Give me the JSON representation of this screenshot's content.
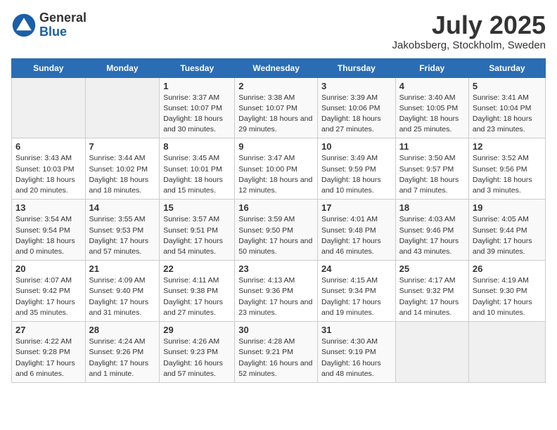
{
  "header": {
    "logo_general": "General",
    "logo_blue": "Blue",
    "month": "July 2025",
    "location": "Jakobsberg, Stockholm, Sweden"
  },
  "weekdays": [
    "Sunday",
    "Monday",
    "Tuesday",
    "Wednesday",
    "Thursday",
    "Friday",
    "Saturday"
  ],
  "weeks": [
    [
      {
        "day": "",
        "empty": true
      },
      {
        "day": "",
        "empty": true
      },
      {
        "day": "1",
        "sunrise": "Sunrise: 3:37 AM",
        "sunset": "Sunset: 10:07 PM",
        "daylight": "Daylight: 18 hours and 30 minutes."
      },
      {
        "day": "2",
        "sunrise": "Sunrise: 3:38 AM",
        "sunset": "Sunset: 10:07 PM",
        "daylight": "Daylight: 18 hours and 29 minutes."
      },
      {
        "day": "3",
        "sunrise": "Sunrise: 3:39 AM",
        "sunset": "Sunset: 10:06 PM",
        "daylight": "Daylight: 18 hours and 27 minutes."
      },
      {
        "day": "4",
        "sunrise": "Sunrise: 3:40 AM",
        "sunset": "Sunset: 10:05 PM",
        "daylight": "Daylight: 18 hours and 25 minutes."
      },
      {
        "day": "5",
        "sunrise": "Sunrise: 3:41 AM",
        "sunset": "Sunset: 10:04 PM",
        "daylight": "Daylight: 18 hours and 23 minutes."
      }
    ],
    [
      {
        "day": "6",
        "sunrise": "Sunrise: 3:43 AM",
        "sunset": "Sunset: 10:03 PM",
        "daylight": "Daylight: 18 hours and 20 minutes."
      },
      {
        "day": "7",
        "sunrise": "Sunrise: 3:44 AM",
        "sunset": "Sunset: 10:02 PM",
        "daylight": "Daylight: 18 hours and 18 minutes."
      },
      {
        "day": "8",
        "sunrise": "Sunrise: 3:45 AM",
        "sunset": "Sunset: 10:01 PM",
        "daylight": "Daylight: 18 hours and 15 minutes."
      },
      {
        "day": "9",
        "sunrise": "Sunrise: 3:47 AM",
        "sunset": "Sunset: 10:00 PM",
        "daylight": "Daylight: 18 hours and 12 minutes."
      },
      {
        "day": "10",
        "sunrise": "Sunrise: 3:49 AM",
        "sunset": "Sunset: 9:59 PM",
        "daylight": "Daylight: 18 hours and 10 minutes."
      },
      {
        "day": "11",
        "sunrise": "Sunrise: 3:50 AM",
        "sunset": "Sunset: 9:57 PM",
        "daylight": "Daylight: 18 hours and 7 minutes."
      },
      {
        "day": "12",
        "sunrise": "Sunrise: 3:52 AM",
        "sunset": "Sunset: 9:56 PM",
        "daylight": "Daylight: 18 hours and 3 minutes."
      }
    ],
    [
      {
        "day": "13",
        "sunrise": "Sunrise: 3:54 AM",
        "sunset": "Sunset: 9:54 PM",
        "daylight": "Daylight: 18 hours and 0 minutes."
      },
      {
        "day": "14",
        "sunrise": "Sunrise: 3:55 AM",
        "sunset": "Sunset: 9:53 PM",
        "daylight": "Daylight: 17 hours and 57 minutes."
      },
      {
        "day": "15",
        "sunrise": "Sunrise: 3:57 AM",
        "sunset": "Sunset: 9:51 PM",
        "daylight": "Daylight: 17 hours and 54 minutes."
      },
      {
        "day": "16",
        "sunrise": "Sunrise: 3:59 AM",
        "sunset": "Sunset: 9:50 PM",
        "daylight": "Daylight: 17 hours and 50 minutes."
      },
      {
        "day": "17",
        "sunrise": "Sunrise: 4:01 AM",
        "sunset": "Sunset: 9:48 PM",
        "daylight": "Daylight: 17 hours and 46 minutes."
      },
      {
        "day": "18",
        "sunrise": "Sunrise: 4:03 AM",
        "sunset": "Sunset: 9:46 PM",
        "daylight": "Daylight: 17 hours and 43 minutes."
      },
      {
        "day": "19",
        "sunrise": "Sunrise: 4:05 AM",
        "sunset": "Sunset: 9:44 PM",
        "daylight": "Daylight: 17 hours and 39 minutes."
      }
    ],
    [
      {
        "day": "20",
        "sunrise": "Sunrise: 4:07 AM",
        "sunset": "Sunset: 9:42 PM",
        "daylight": "Daylight: 17 hours and 35 minutes."
      },
      {
        "day": "21",
        "sunrise": "Sunrise: 4:09 AM",
        "sunset": "Sunset: 9:40 PM",
        "daylight": "Daylight: 17 hours and 31 minutes."
      },
      {
        "day": "22",
        "sunrise": "Sunrise: 4:11 AM",
        "sunset": "Sunset: 9:38 PM",
        "daylight": "Daylight: 17 hours and 27 minutes."
      },
      {
        "day": "23",
        "sunrise": "Sunrise: 4:13 AM",
        "sunset": "Sunset: 9:36 PM",
        "daylight": "Daylight: 17 hours and 23 minutes."
      },
      {
        "day": "24",
        "sunrise": "Sunrise: 4:15 AM",
        "sunset": "Sunset: 9:34 PM",
        "daylight": "Daylight: 17 hours and 19 minutes."
      },
      {
        "day": "25",
        "sunrise": "Sunrise: 4:17 AM",
        "sunset": "Sunset: 9:32 PM",
        "daylight": "Daylight: 17 hours and 14 minutes."
      },
      {
        "day": "26",
        "sunrise": "Sunrise: 4:19 AM",
        "sunset": "Sunset: 9:30 PM",
        "daylight": "Daylight: 17 hours and 10 minutes."
      }
    ],
    [
      {
        "day": "27",
        "sunrise": "Sunrise: 4:22 AM",
        "sunset": "Sunset: 9:28 PM",
        "daylight": "Daylight: 17 hours and 6 minutes."
      },
      {
        "day": "28",
        "sunrise": "Sunrise: 4:24 AM",
        "sunset": "Sunset: 9:26 PM",
        "daylight": "Daylight: 17 hours and 1 minute."
      },
      {
        "day": "29",
        "sunrise": "Sunrise: 4:26 AM",
        "sunset": "Sunset: 9:23 PM",
        "daylight": "Daylight: 16 hours and 57 minutes."
      },
      {
        "day": "30",
        "sunrise": "Sunrise: 4:28 AM",
        "sunset": "Sunset: 9:21 PM",
        "daylight": "Daylight: 16 hours and 52 minutes."
      },
      {
        "day": "31",
        "sunrise": "Sunrise: 4:30 AM",
        "sunset": "Sunset: 9:19 PM",
        "daylight": "Daylight: 16 hours and 48 minutes."
      },
      {
        "day": "",
        "empty": true
      },
      {
        "day": "",
        "empty": true
      }
    ]
  ]
}
